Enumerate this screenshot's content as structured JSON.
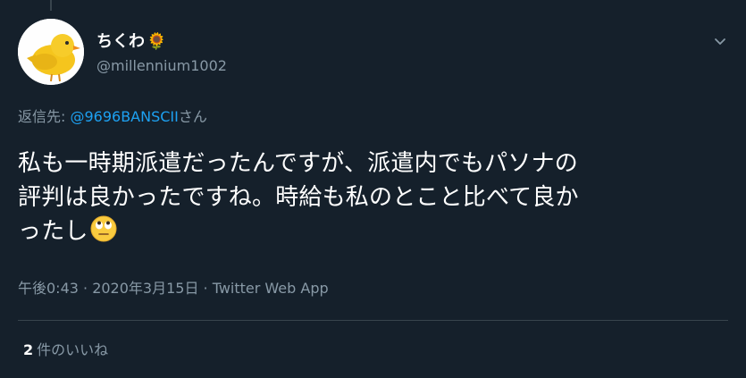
{
  "user": {
    "display_name": "ちくわ",
    "name_emoji": "🌻",
    "handle": "@millennium1002",
    "avatar_icon": "yellow-bird-avatar"
  },
  "reply": {
    "prefix": "返信先: ",
    "mention": "@9696BANSCII",
    "suffix": "さん"
  },
  "tweet": {
    "lines": [
      "私も一時期派遣だったんですが、派遣内でもパソナの",
      "評判は良かったですね。時給も私のとこと比べて良か",
      "ったし"
    ],
    "trailing_emoji": "face-with-rolling-eyes-icon"
  },
  "meta": {
    "timestamp": "午後0:43 · 2020年3月15日 · Twitter Web App"
  },
  "likes": {
    "count": "2",
    "label": "件のいいね"
  },
  "colors": {
    "background": "#15202b",
    "secondary_text": "#8899a6",
    "link": "#1da1f2",
    "divider": "#38444d"
  }
}
